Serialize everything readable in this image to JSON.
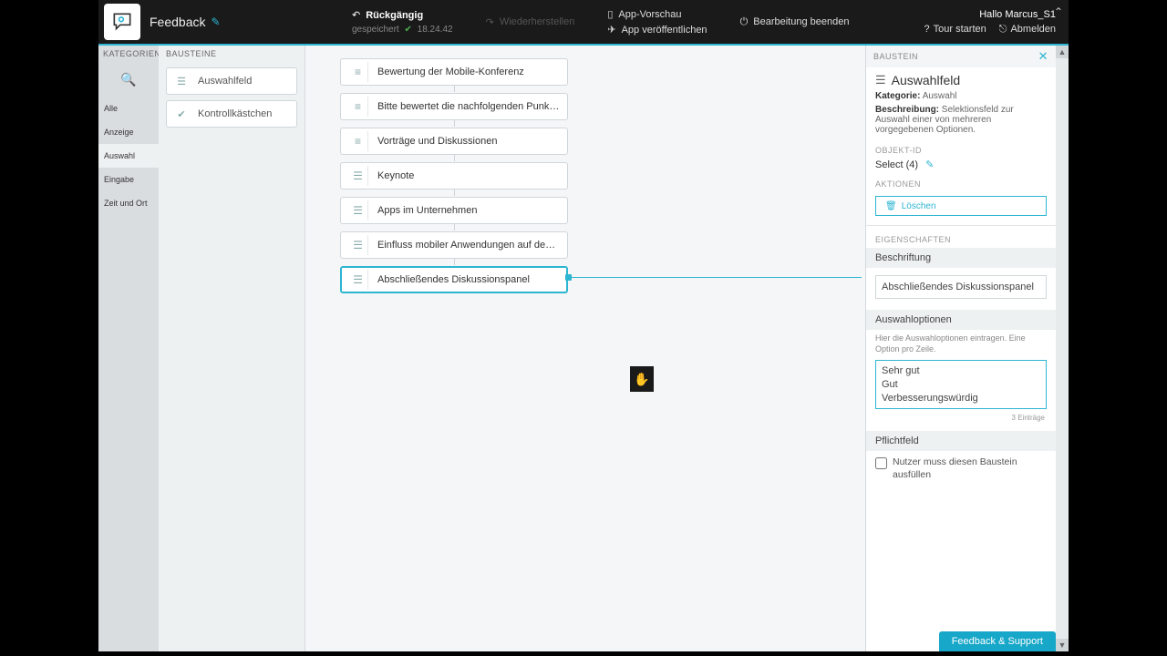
{
  "topbar": {
    "app_name": "Feedback",
    "undo": "Rückgängig",
    "redo": "Wiederherstellen",
    "preview": "App-Vorschau",
    "publish": "App veröffentlichen",
    "end_edit": "Bearbeitung beenden",
    "saved_label": "gespeichert",
    "saved_time": "18.24.42",
    "greeting": "Hallo Marcus_S1",
    "start_tour": "Tour starten",
    "logout": "Abmelden"
  },
  "rail": {
    "header": "KATEGORIEN",
    "items": [
      "Alle",
      "Anzeige",
      "Auswahl",
      "Eingabe",
      "Zeit und Ort"
    ]
  },
  "palette": {
    "header": "BAUSTEINE",
    "blocks": [
      {
        "label": "Auswahlfeld"
      },
      {
        "label": "Kontrollkästchen"
      }
    ]
  },
  "canvas": {
    "nodes": [
      {
        "type": "text",
        "label": "Bewertung der Mobile-Konferenz"
      },
      {
        "type": "text",
        "label": "Bitte bewertet die nachfolgenden Punkte:"
      },
      {
        "type": "text",
        "label": "Vorträge und Diskussionen"
      },
      {
        "type": "select",
        "label": "Keynote"
      },
      {
        "type": "select",
        "label": "Apps im Unternehmen"
      },
      {
        "type": "select",
        "label": "Einfluss mobiler Anwendungen auf den G..."
      },
      {
        "type": "select",
        "label": "Abschließendes Diskussionspanel",
        "selected": true
      }
    ]
  },
  "inspector": {
    "strip": "BAUSTEIN",
    "title": "Auswahlfeld",
    "category_label": "Kategorie:",
    "category_value": "Auswahl",
    "descr_label": "Beschreibung:",
    "descr_value": "Selektionsfeld zur Auswahl einer von mehreren vorgegebenen Optionen.",
    "objid_header": "OBJEKT-ID",
    "objid_value": "Select (4)",
    "actions_header": "AKTIONEN",
    "delete_label": "Löschen",
    "props_header": "EIGENSCHAFTEN",
    "beschriftung_label": "Beschriftung",
    "beschriftung_value": "Abschließendes Diskussionspanel",
    "options_label": "Auswahloptionen",
    "options_helper": "Hier die Auswahloptionen eintragen. Eine Option pro Zeile.",
    "options_value": "Sehr gut\nGut\nVerbesserungswürdig",
    "options_count": "3 Einträge",
    "pflicht_label": "Pflichtfeld",
    "pflicht_text": "Nutzer muss diesen Baustein ausfüllen"
  },
  "feedback_button": "Feedback & Support"
}
